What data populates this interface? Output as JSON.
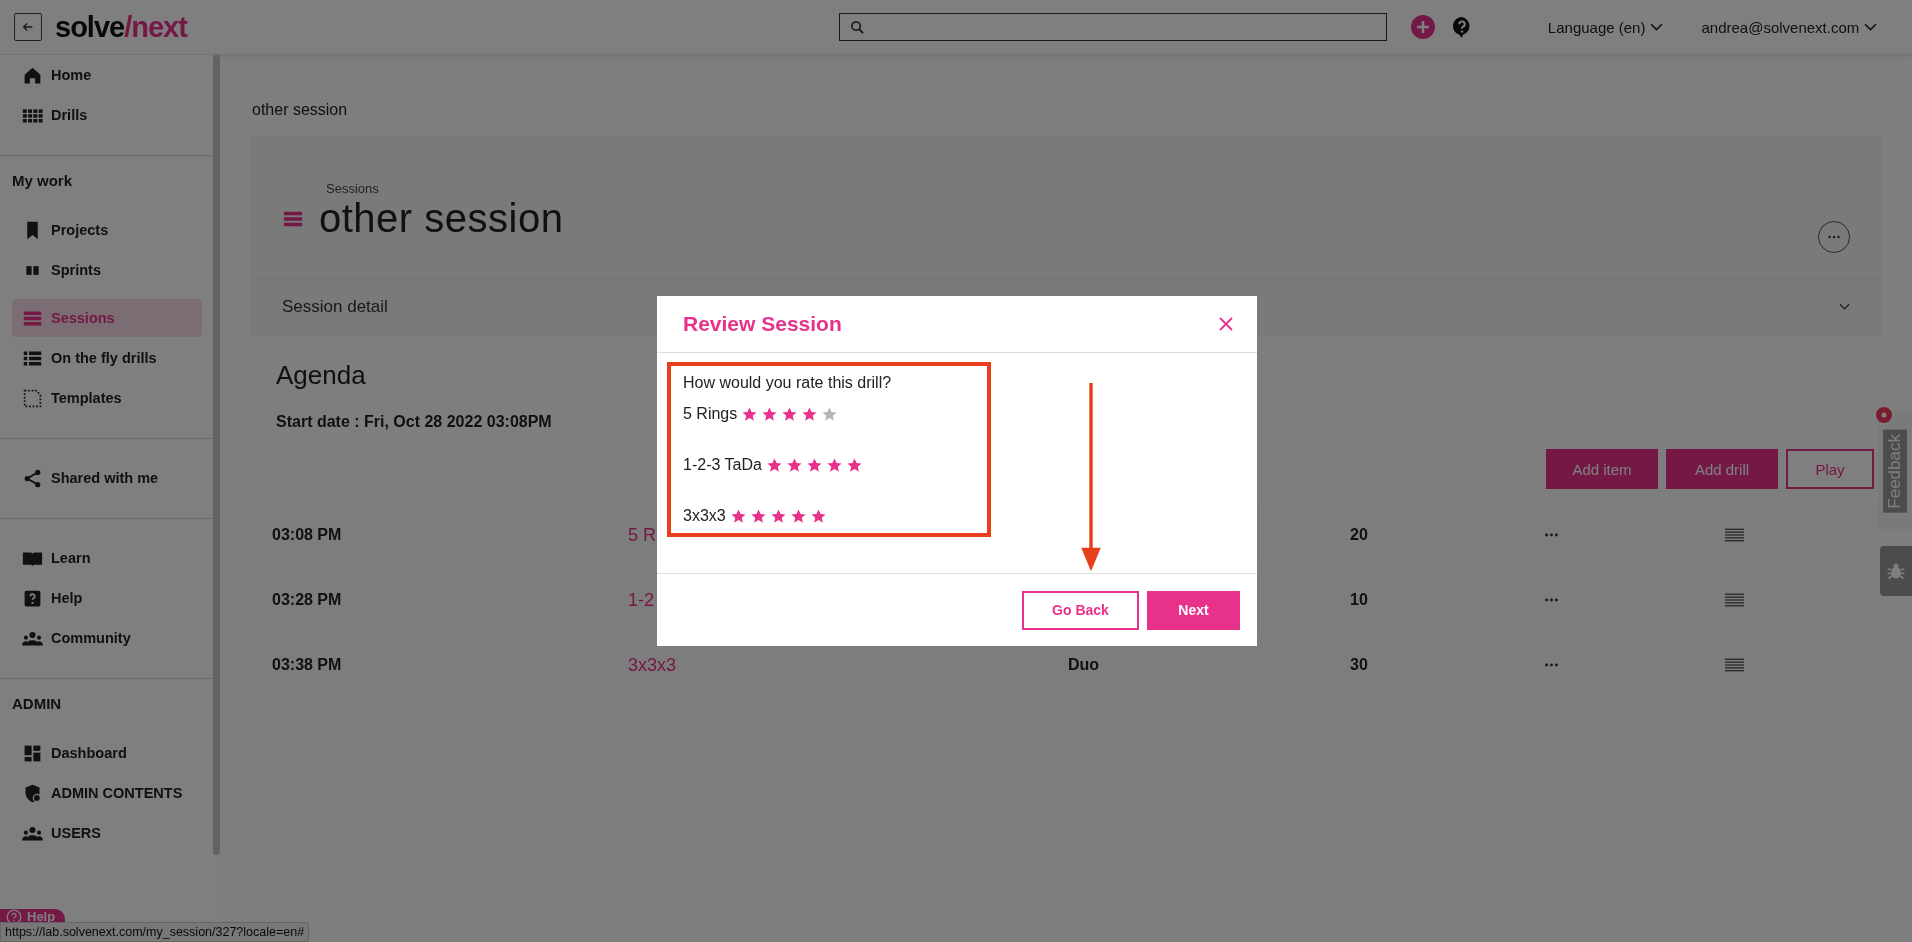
{
  "top_bar": {
    "logo": {
      "part_1": "solve",
      "separator": "/",
      "part_2": "next"
    },
    "language": "Language (en)",
    "user": "andrea@solvenext.com"
  },
  "sidebar": {
    "sections": [
      {
        "items": [
          {
            "label": "Home",
            "selected": false
          },
          {
            "label": "Drills",
            "selected": false
          }
        ]
      },
      {
        "heading": "My work",
        "items": [
          {
            "label": "Projects",
            "selected": false
          },
          {
            "label": "Sprints",
            "selected": false
          },
          {
            "label": "Sessions",
            "selected": true
          },
          {
            "label": "On the fly drills",
            "selected": false
          },
          {
            "label": "Templates",
            "selected": false
          }
        ]
      },
      {
        "items": [
          {
            "label": "Shared with me",
            "selected": false
          }
        ]
      },
      {
        "items": [
          {
            "label": "Learn",
            "selected": false
          },
          {
            "label": "Help",
            "selected": false
          },
          {
            "label": "Community",
            "selected": false
          }
        ]
      },
      {
        "heading": "ADMIN",
        "items": [
          {
            "label": "Dashboard",
            "selected": false
          },
          {
            "label": "ADMIN CONTENTS",
            "selected": false
          },
          {
            "label": "USERS",
            "selected": false
          }
        ]
      }
    ]
  },
  "breadcrumb": "other session",
  "header": {
    "section": "Sessions",
    "title": "other session"
  },
  "detail_panel": {
    "label": "Session detail",
    "expanded": false
  },
  "agenda": {
    "title": "Agenda",
    "start_date": "Start date : Fri, Oct 28 2022 03:08PM",
    "buttons": [
      {
        "label": "Add item",
        "kind": "filled"
      },
      {
        "label": "Add drill",
        "kind": "filled"
      },
      {
        "label": "Play",
        "kind": "outline"
      }
    ],
    "rows": [
      {
        "time": "03:08 PM",
        "drill": "5 R",
        "duration": "20"
      },
      {
        "time": "03:28 PM",
        "drill": "1-2",
        "duration": "10"
      },
      {
        "time": "03:38 PM",
        "drill": "3x3x3",
        "type": "Duo",
        "duration": "30"
      }
    ]
  },
  "modal": {
    "title": "Review Session",
    "question": "How would you rate this drill?",
    "ratings": [
      {
        "drill": "5 Rings",
        "stars": 4
      },
      {
        "drill": "1-2-3 TaDa",
        "stars": 5
      },
      {
        "drill": "3x3x3",
        "stars": 5
      }
    ],
    "buttons": [
      {
        "label": "Go Back",
        "kind": "outline"
      },
      {
        "label": "Next",
        "kind": "filled"
      }
    ]
  },
  "feedback_tab": {
    "label": "Feedback"
  },
  "help_button": {
    "label": "Help"
  },
  "status_url": "https://lab.solvenext.com/my_session/327?locale=en#"
}
